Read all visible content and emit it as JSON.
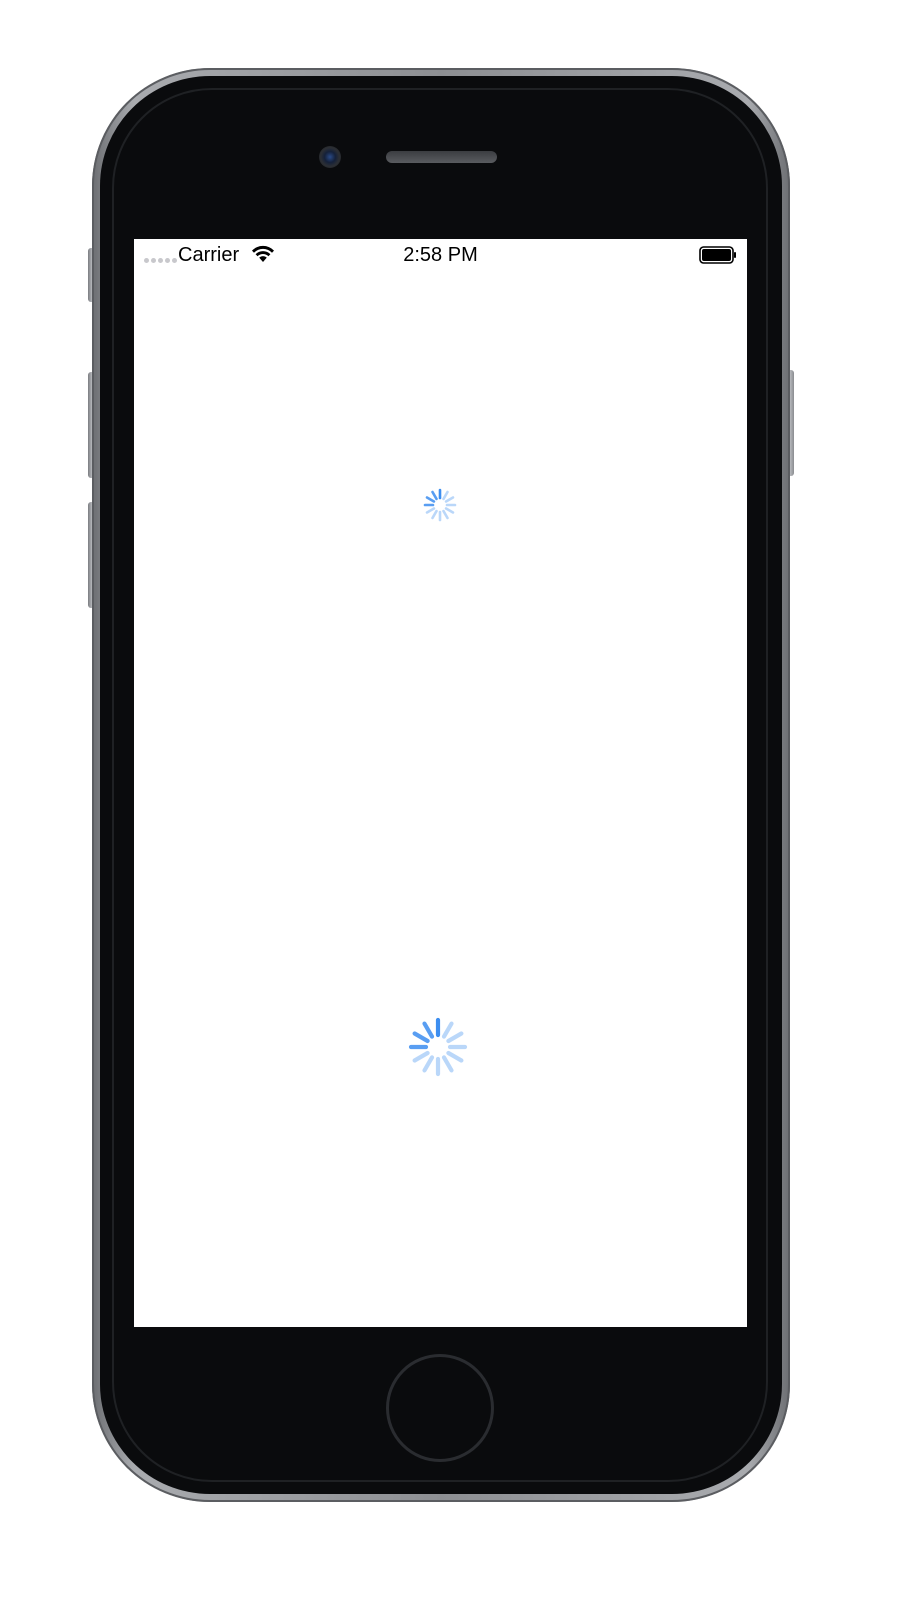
{
  "status_bar": {
    "carrier": "Carrier",
    "time": "2:58 PM",
    "signal_icon": "signal-dots-icon",
    "wifi_icon": "wifi-icon",
    "battery_icon": "battery-icon"
  },
  "content": {
    "spinners": [
      {
        "name": "activity-indicator-small",
        "size": "small",
        "color": "#3d8ef0"
      },
      {
        "name": "activity-indicator-large",
        "size": "large",
        "color": "#3d8ef0"
      }
    ]
  },
  "device": {
    "frame_color": "#0a0b0d",
    "screen_color": "#ffffff"
  }
}
